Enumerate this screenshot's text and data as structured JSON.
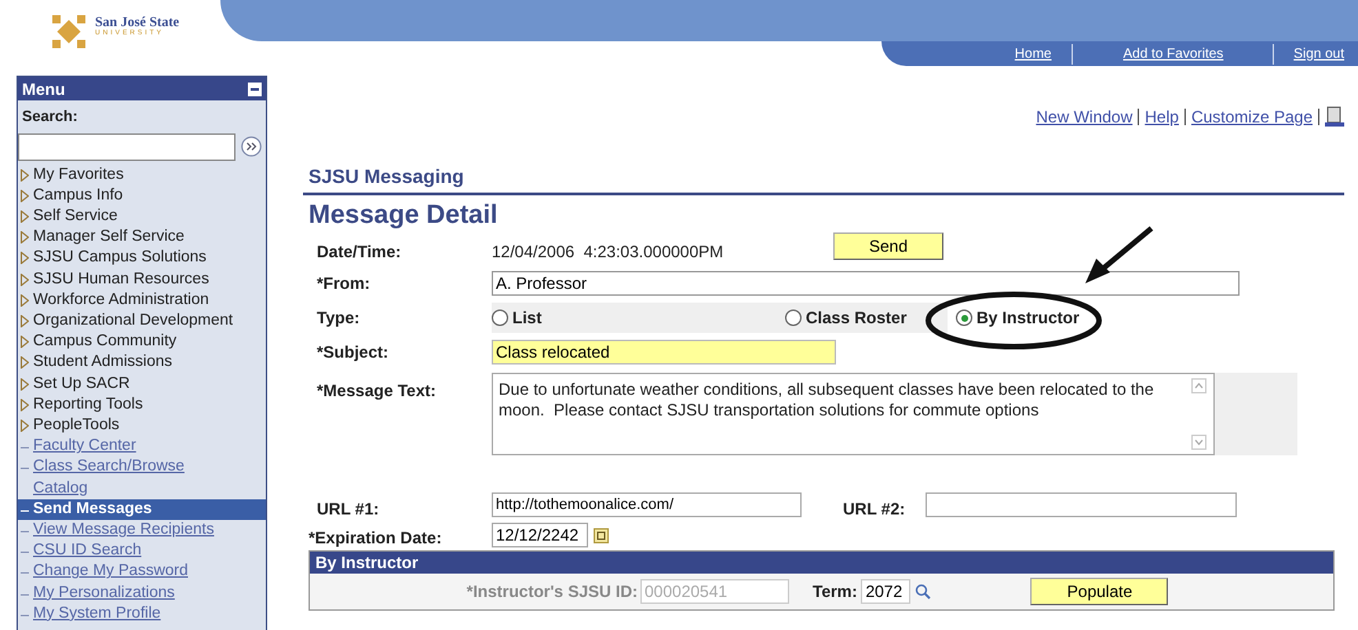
{
  "header": {
    "logo_name": "San José State",
    "logo_sub": "UNIVERSITY",
    "nav_links": [
      "Home",
      "Add to Favorites",
      "Sign out"
    ]
  },
  "menu": {
    "title": "Menu",
    "search_label": "Search:",
    "items": [
      {
        "label": "My Favorites",
        "kind": "folder",
        "selected": false
      },
      {
        "label": "Campus Info",
        "kind": "folder",
        "selected": false
      },
      {
        "label": "Self Service",
        "kind": "folder",
        "selected": false
      },
      {
        "label": "Manager Self Service",
        "kind": "folder",
        "selected": false
      },
      {
        "label": "SJSU Campus Solutions",
        "kind": "folder",
        "selected": false
      },
      {
        "label": "SJSU Human Resources",
        "kind": "folder",
        "selected": false
      },
      {
        "label": "Workforce Administration",
        "kind": "folder",
        "selected": false
      },
      {
        "label": "Organizational Development",
        "kind": "folder",
        "selected": false
      },
      {
        "label": "Campus Community",
        "kind": "folder",
        "selected": false
      },
      {
        "label": "Student Admissions",
        "kind": "folder",
        "selected": false
      },
      {
        "label": "Set Up SACR",
        "kind": "folder",
        "selected": false
      },
      {
        "label": "Reporting Tools",
        "kind": "folder",
        "selected": false
      },
      {
        "label": "PeopleTools",
        "kind": "folder",
        "selected": false
      },
      {
        "label": "Faculty Center",
        "kind": "link",
        "selected": false
      },
      {
        "label": "Class Search/Browse Catalog",
        "kind": "link",
        "selected": false
      },
      {
        "label": "Send Messages",
        "kind": "link",
        "selected": true
      },
      {
        "label": "View Message Recipients",
        "kind": "link",
        "selected": false
      },
      {
        "label": "CSU ID Search",
        "kind": "link",
        "selected": false
      },
      {
        "label": "Change My Password",
        "kind": "link",
        "selected": false
      },
      {
        "label": "My Personalizations",
        "kind": "link",
        "selected": false
      },
      {
        "label": "My System Profile",
        "kind": "link",
        "selected": false
      }
    ]
  },
  "page_links": [
    "New Window",
    "Help",
    "Customize Page"
  ],
  "section_title": "SJSU Messaging",
  "page_title": "Message Detail",
  "form": {
    "date_label": "Date/Time:",
    "date_value": "12/04/2006  4:23:03.000000PM",
    "send_button": "Send",
    "from": {
      "label": "*From:",
      "value": "A. Professor"
    },
    "type": {
      "label": "Type:",
      "options": [
        {
          "label": "List",
          "selected": false
        },
        {
          "label": "Class Roster",
          "selected": false
        },
        {
          "label": "By Instructor",
          "selected": true
        }
      ]
    },
    "subject": {
      "label": "*Subject:",
      "value": "Class relocated"
    },
    "message": {
      "label": "*Message Text:",
      "lines": [
        "Due to unfortunate weather conditions, all subsequent classes have been relocated to the",
        "moon.  Please contact SJSU transportation solutions for commute options"
      ]
    },
    "url1": {
      "label": "URL #1:",
      "value": "http://tothemoonalice.com/"
    },
    "url2": {
      "label": "URL #2:"
    },
    "expiration": {
      "label": "*Expiration Date:",
      "value": "12/12/2242"
    }
  },
  "by_instructor": {
    "title": "By Instructor",
    "id_label": "*Instructor's SJSU ID:",
    "id_value": "000020541",
    "term_label": "Term:",
    "term_value": "2072",
    "populate_button": "Populate"
  }
}
